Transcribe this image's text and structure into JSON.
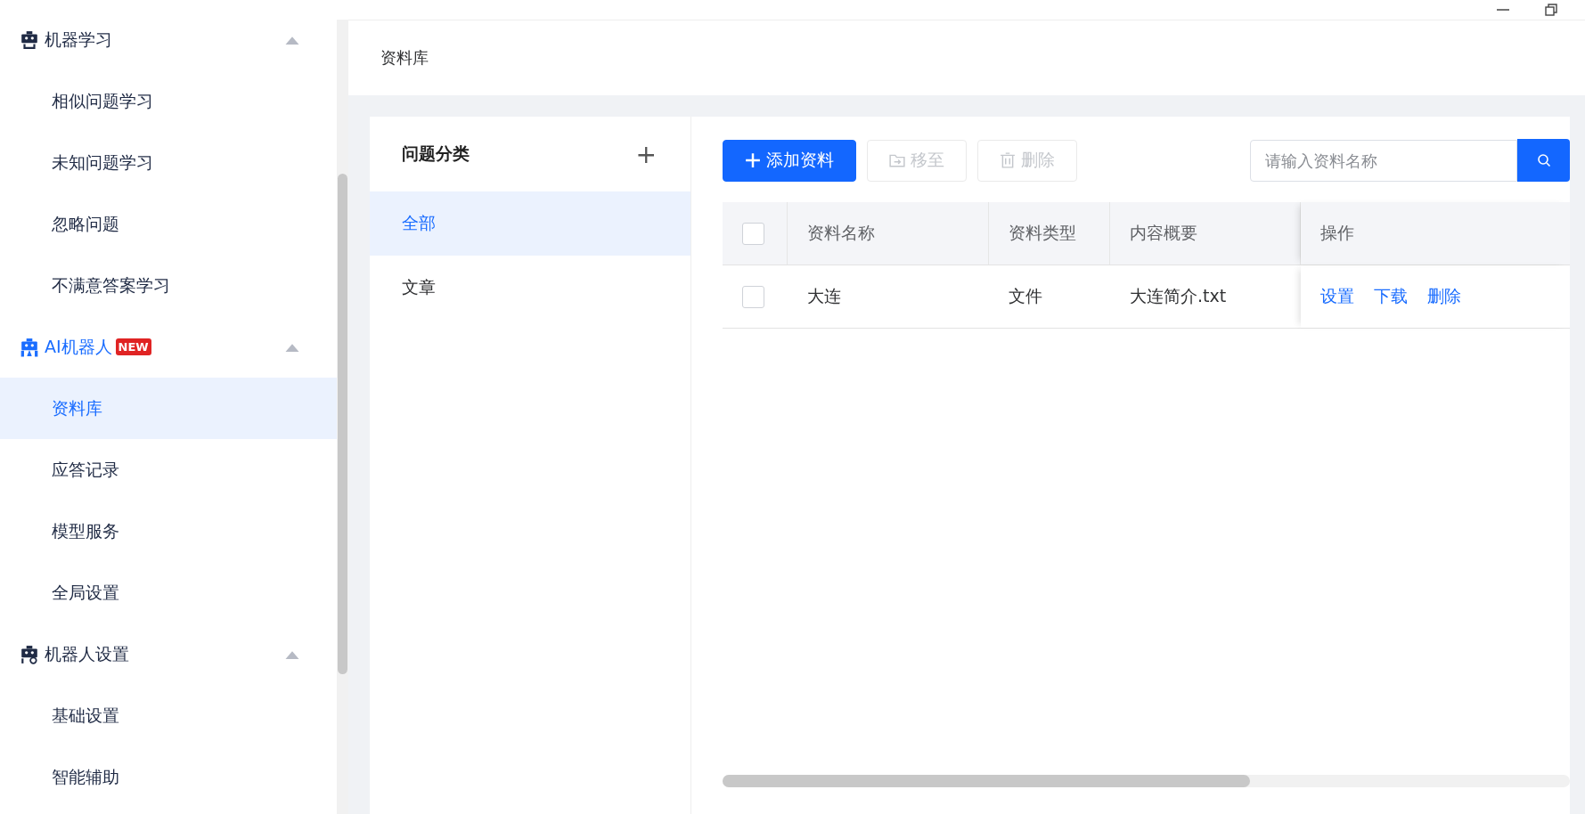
{
  "sidebar": {
    "groups": [
      {
        "label": "机器学习",
        "active": false,
        "expanded": true,
        "children": [
          {
            "label": "相似问题学习",
            "selected": false
          },
          {
            "label": "未知问题学习",
            "selected": false
          },
          {
            "label": "忽略问题",
            "selected": false
          },
          {
            "label": "不满意答案学习",
            "selected": false
          }
        ]
      },
      {
        "label": "AI机器人",
        "badge": "NEW",
        "active": true,
        "expanded": true,
        "children": [
          {
            "label": "资料库",
            "selected": true
          },
          {
            "label": "应答记录",
            "selected": false
          },
          {
            "label": "模型服务",
            "selected": false
          },
          {
            "label": "全局设置",
            "selected": false
          }
        ]
      },
      {
        "label": "机器人设置",
        "active": false,
        "expanded": true,
        "children": [
          {
            "label": "基础设置",
            "selected": false
          },
          {
            "label": "智能辅助",
            "selected": false
          }
        ]
      }
    ]
  },
  "page_title": "资料库",
  "categories": {
    "title": "问题分类",
    "add_symbol": "+",
    "items": [
      {
        "label": "全部",
        "selected": true
      },
      {
        "label": "文章",
        "selected": false
      }
    ]
  },
  "toolbar": {
    "buttons": [
      {
        "kind": "add",
        "label": "添加资料",
        "disabled": false
      },
      {
        "kind": "move",
        "label": "移至",
        "disabled": true
      },
      {
        "kind": "delete",
        "label": "删除",
        "disabled": true
      }
    ],
    "search": {
      "placeholder": "请输入资料名称"
    }
  },
  "table": {
    "select_all": {
      "checked": false
    },
    "columns": [
      "资料名称",
      "资料类型",
      "内容概要",
      "操作"
    ],
    "rows": [
      {
        "checked": false,
        "cells": [
          "大连",
          "文件",
          "大连简介.txt"
        ],
        "actions": [
          "设置",
          "下载",
          "删除"
        ]
      }
    ]
  }
}
